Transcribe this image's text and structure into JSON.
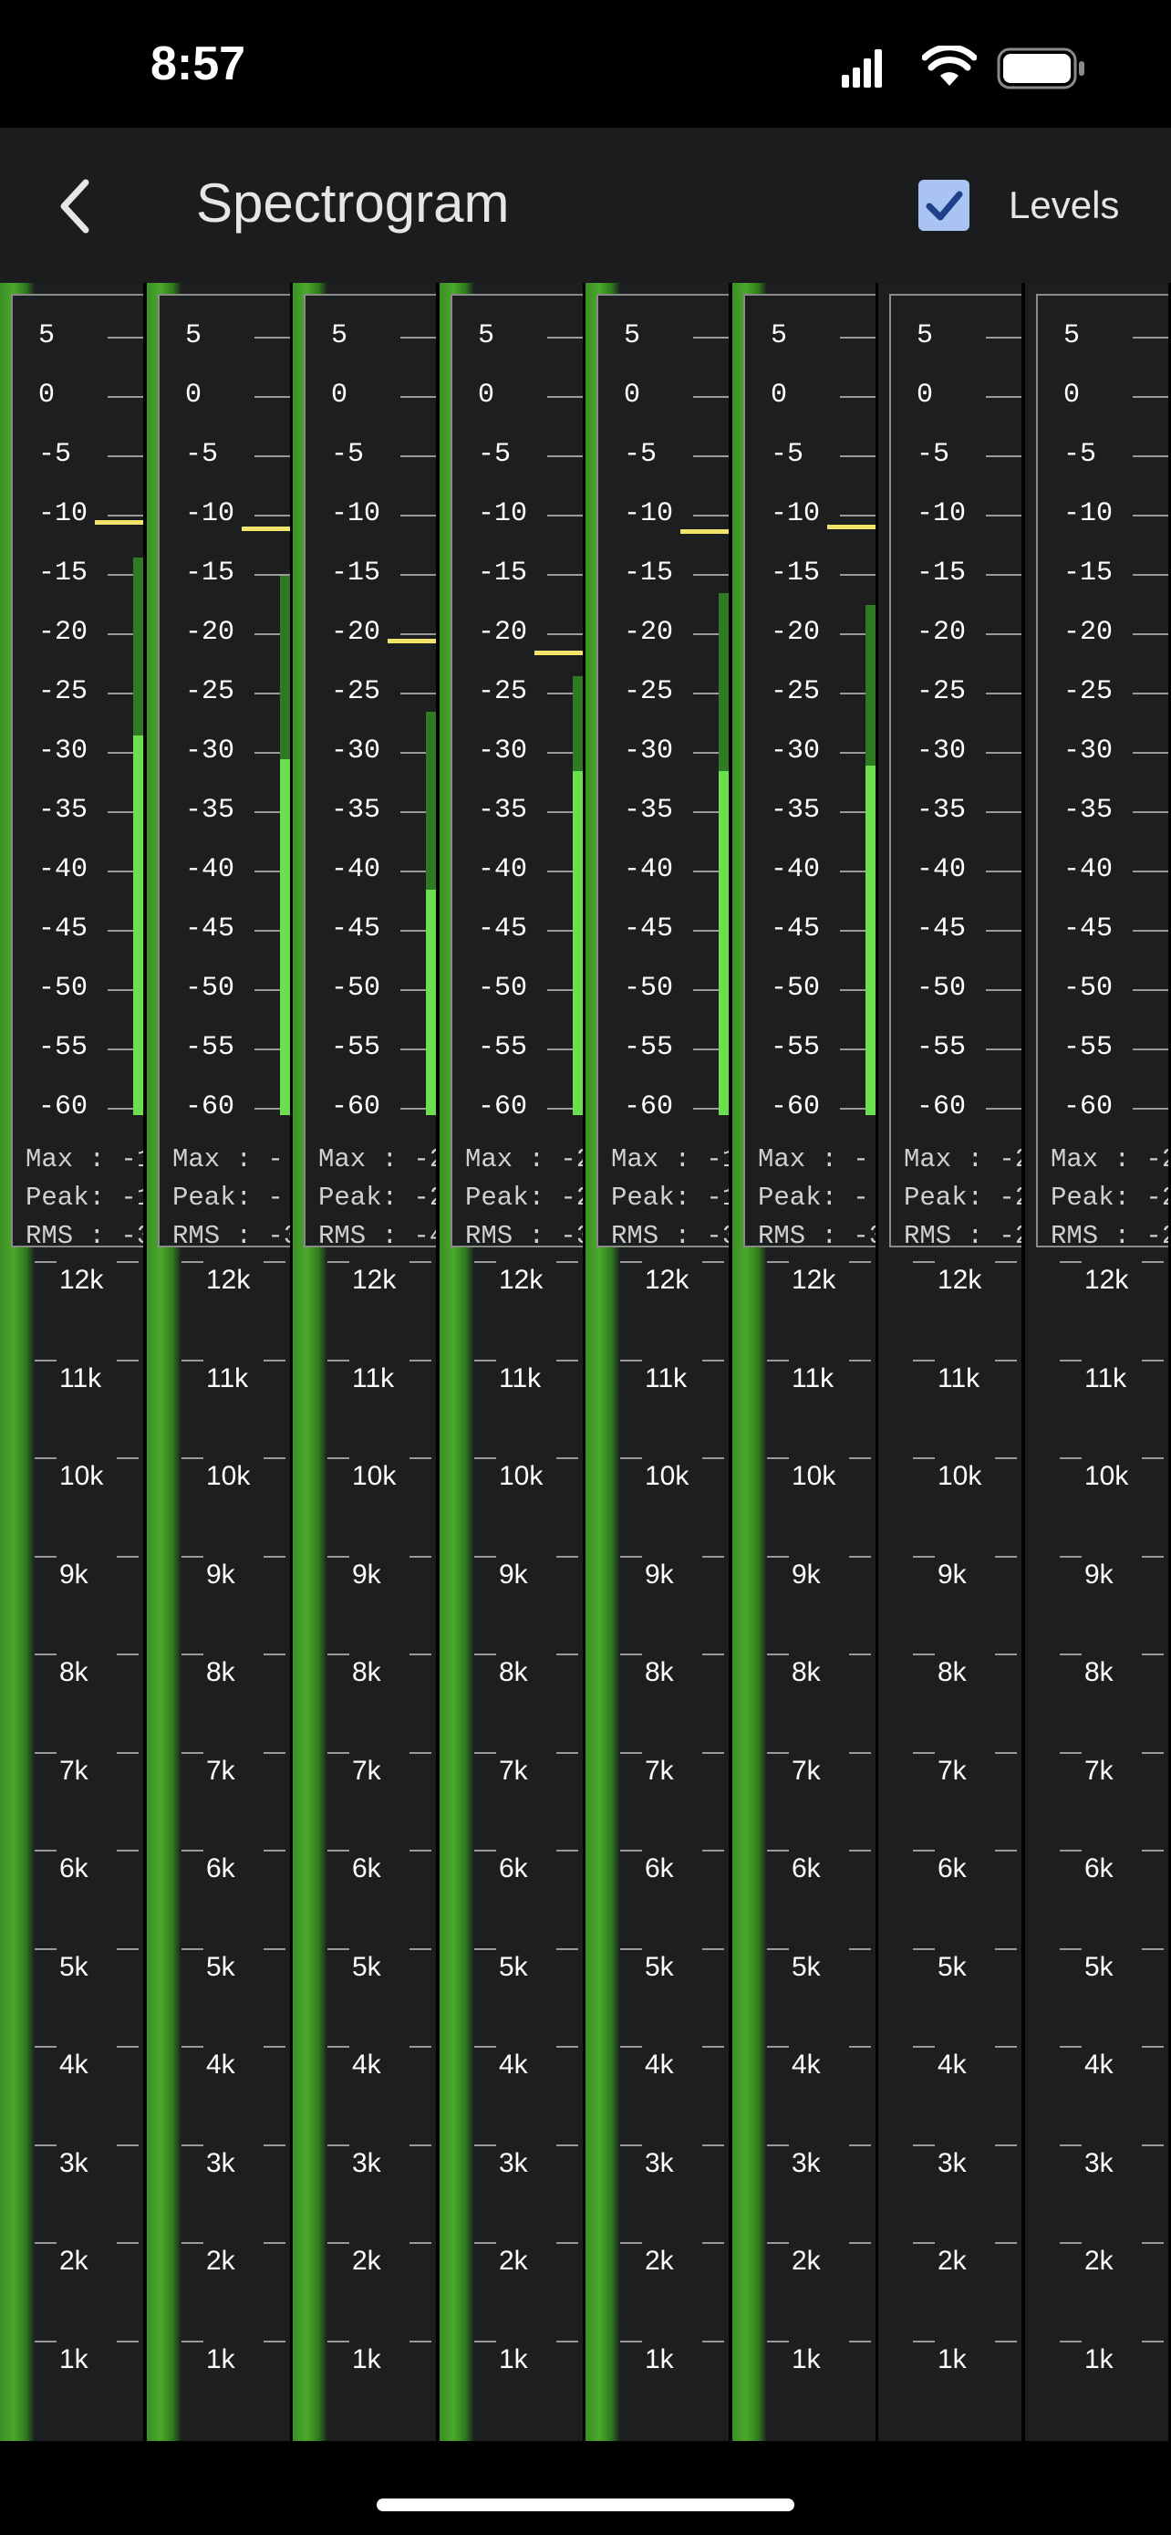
{
  "status_bar": {
    "time": "8:57"
  },
  "nav": {
    "title": "Spectrogram",
    "levels_label": "Levels",
    "levels_checked": true
  },
  "colors": {
    "meter_bar": "#6be04f",
    "meter_bar_dim": "#2e7a25",
    "peak_line": "#f2e36b",
    "checkbox": "#a9c4f2"
  },
  "db_scale": [
    "5",
    "0",
    "-5",
    "-10",
    "-15",
    "-20",
    "-25",
    "-30",
    "-35",
    "-40",
    "-45",
    "-50",
    "-55",
    "-60"
  ],
  "freq_scale": [
    "12k",
    "11k",
    "10k",
    "9k",
    "8k",
    "7k",
    "6k",
    "5k",
    "4k",
    "3k",
    "2k",
    "1k"
  ],
  "stat_labels": {
    "max": "Max : -",
    "peak": "Peak: -",
    "rms": "RMS : -"
  },
  "channels": [
    {
      "id": 1,
      "peak_db": -12.0,
      "max_db": -15.0,
      "rms_db": -30.0,
      "active": true,
      "max": "Max : -1",
      "peak": "Peak: -1",
      "rms": "RMS : -3"
    },
    {
      "id": 2,
      "peak_db": -12.5,
      "max_db": -16.5,
      "rms_db": -32.0,
      "active": true,
      "max": "Max : -",
      "peak": "Peak: -",
      "rms": "RMS : -3"
    },
    {
      "id": 3,
      "peak_db": -22.0,
      "max_db": -28.0,
      "rms_db": -43.0,
      "active": true,
      "max": "Max : -2",
      "peak": "Peak: -2",
      "rms": "RMS : -4"
    },
    {
      "id": 4,
      "peak_db": -23.0,
      "max_db": -25.0,
      "rms_db": -33.0,
      "active": true,
      "max": "Max : -2",
      "peak": "Peak: -2",
      "rms": "RMS : -3"
    },
    {
      "id": 5,
      "peak_db": -12.8,
      "max_db": -18.0,
      "rms_db": -33.0,
      "active": true,
      "max": "Max : -1",
      "peak": "Peak: -1",
      "rms": "RMS : -3"
    },
    {
      "id": 6,
      "peak_db": -12.4,
      "max_db": -19.0,
      "rms_db": -32.5,
      "active": true,
      "max": "Max : -",
      "peak": "Peak: -",
      "rms": "RMS : -3"
    },
    {
      "id": 7,
      "peak_db": null,
      "max_db": null,
      "rms_db": null,
      "active": false,
      "max": "Max : -2",
      "peak": "Peak: -2",
      "rms": "RMS : -2"
    },
    {
      "id": 8,
      "peak_db": null,
      "max_db": null,
      "rms_db": null,
      "active": false,
      "max": "Max : -2",
      "peak": "Peak: -2",
      "rms": "RMS : -2"
    }
  ]
}
